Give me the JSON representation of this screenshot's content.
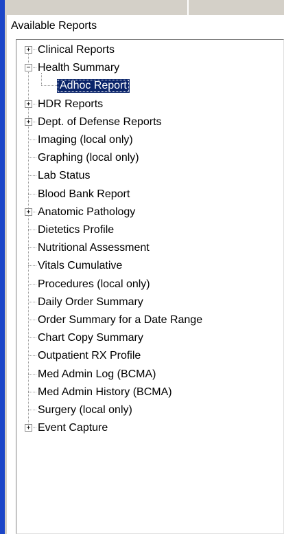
{
  "panel": {
    "label": "Available Reports"
  },
  "tree": {
    "items": [
      {
        "label": "Clinical Reports",
        "level": 0,
        "expander": "plus"
      },
      {
        "label": "Health Summary",
        "level": 0,
        "expander": "minus"
      },
      {
        "label": "Adhoc Report",
        "level": 1,
        "expander": "none",
        "selected": true
      },
      {
        "label": "HDR Reports",
        "level": 0,
        "expander": "plus"
      },
      {
        "label": "Dept. of Defense Reports",
        "level": 0,
        "expander": "plus"
      },
      {
        "label": "Imaging (local only)",
        "level": 0,
        "expander": "none"
      },
      {
        "label": "Graphing (local only)",
        "level": 0,
        "expander": "none"
      },
      {
        "label": "Lab Status",
        "level": 0,
        "expander": "none"
      },
      {
        "label": "Blood Bank Report",
        "level": 0,
        "expander": "none"
      },
      {
        "label": "Anatomic Pathology",
        "level": 0,
        "expander": "plus"
      },
      {
        "label": "Dietetics Profile",
        "level": 0,
        "expander": "none"
      },
      {
        "label": "Nutritional Assessment",
        "level": 0,
        "expander": "none"
      },
      {
        "label": "Vitals Cumulative",
        "level": 0,
        "expander": "none"
      },
      {
        "label": "Procedures (local only)",
        "level": 0,
        "expander": "none"
      },
      {
        "label": "Daily Order Summary",
        "level": 0,
        "expander": "none"
      },
      {
        "label": "Order Summary for a Date Range",
        "level": 0,
        "expander": "none"
      },
      {
        "label": "Chart Copy Summary",
        "level": 0,
        "expander": "none"
      },
      {
        "label": "Outpatient RX Profile",
        "level": 0,
        "expander": "none"
      },
      {
        "label": "Med Admin Log (BCMA)",
        "level": 0,
        "expander": "none"
      },
      {
        "label": "Med Admin History (BCMA)",
        "level": 0,
        "expander": "none"
      },
      {
        "label": "Surgery (local only)",
        "level": 0,
        "expander": "none"
      },
      {
        "label": "Event Capture",
        "level": 0,
        "expander": "plus"
      }
    ]
  },
  "colors": {
    "selection": "#0a246a",
    "window_edge": "#1c46c8",
    "face": "#d4d0c8"
  }
}
